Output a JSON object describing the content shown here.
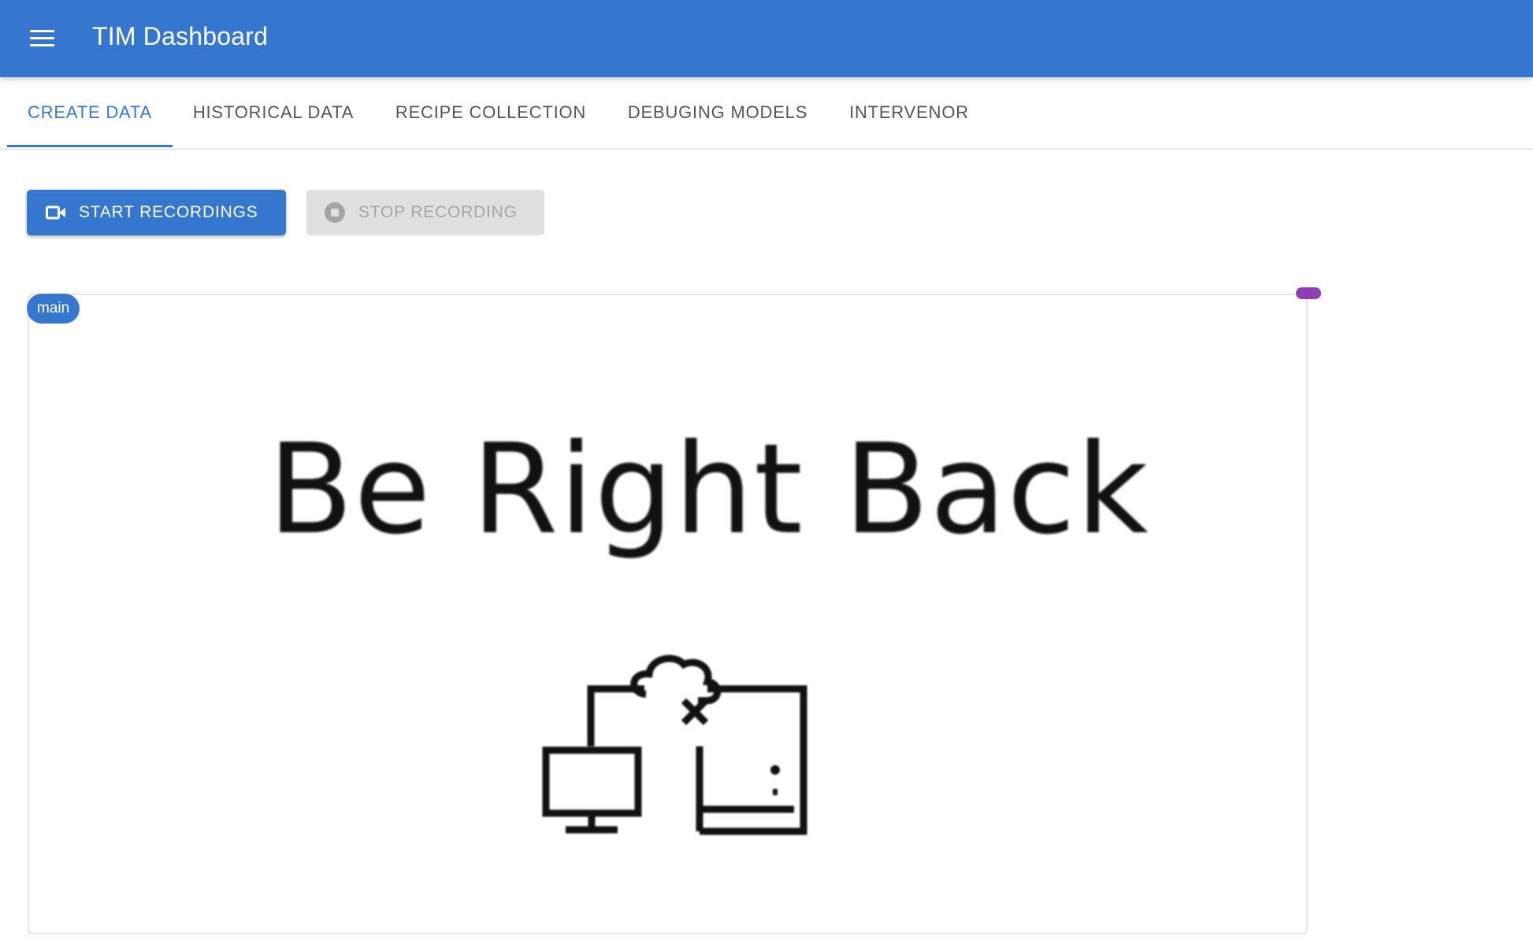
{
  "header": {
    "title": "TIM Dashboard"
  },
  "tabs": [
    {
      "label": "CREATE DATA",
      "active": true
    },
    {
      "label": "HISTORICAL DATA",
      "active": false
    },
    {
      "label": "RECIPE COLLECTION",
      "active": false
    },
    {
      "label": "DEBUGING MODELS",
      "active": false
    },
    {
      "label": "INTERVENOR",
      "active": false
    }
  ],
  "toolbar": {
    "start_label": "START RECORDINGS",
    "start_icon": "videocam-icon",
    "stop_label": "STOP RECORDING",
    "stop_icon": "stop-circle-icon",
    "stop_disabled": true
  },
  "stream": {
    "label": "main",
    "placeholder_text": "Be Right Back",
    "placeholder_icon": "disconnected-devices-icon",
    "status_color": "#8e3fb5"
  },
  "colors": {
    "primary": "#3577cf",
    "disabled_bg": "#e0e0e0",
    "disabled_text": "#a5a5a5"
  }
}
